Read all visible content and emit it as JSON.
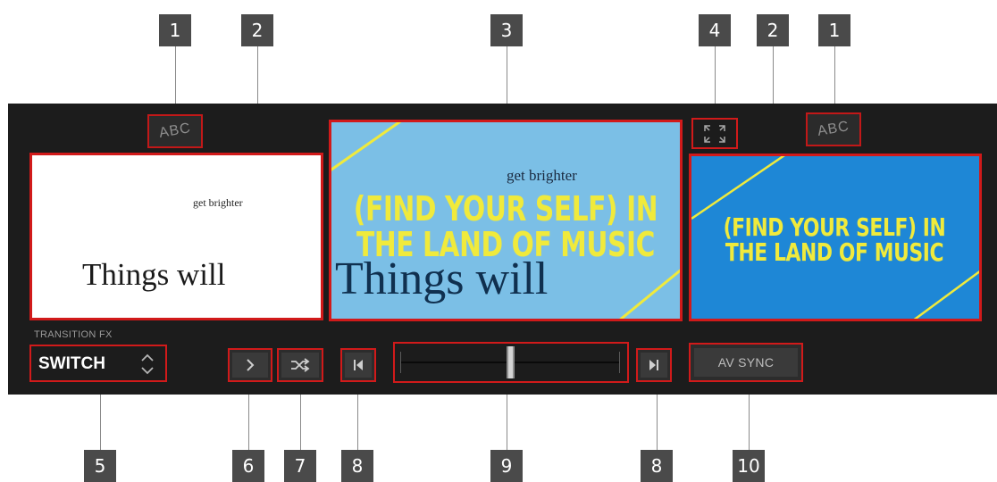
{
  "callouts": {
    "top": [
      "1",
      "2",
      "3",
      "4",
      "2",
      "1"
    ],
    "bottom": [
      "5",
      "6",
      "7",
      "8",
      "9",
      "8",
      "10"
    ]
  },
  "decks": {
    "left_abc": "ABC",
    "right_abc": "ABC"
  },
  "screens": {
    "left": {
      "small_text": "get brighter",
      "big_text": "Things will"
    },
    "center": {
      "small_text": "get brighter",
      "yellow_line1": "(FIND YOUR SELF) IN",
      "yellow_line2": "THE LAND OF MUSIC",
      "big_text": "Things will"
    },
    "right": {
      "yellow_line1": "(FIND YOUR SELF) IN",
      "yellow_line2": "THE LAND OF MUSIC"
    }
  },
  "transition": {
    "label": "TRANSITION FX",
    "value": "SWITCH"
  },
  "buttons": {
    "av_sync": "AV SYNC"
  },
  "crossfader": {
    "position": 0.5
  },
  "colors": {
    "panel_bg": "#1c1c1c",
    "highlight": "#d11a1a",
    "center_screen_bg": "#7bbfe6",
    "right_screen_bg": "#1e87d6",
    "lyric_yellow": "#f0ea3c"
  },
  "icons": {
    "fullscreen": "expand-icon",
    "play": "chevron-right-icon",
    "shuffle": "shuffle-icon",
    "prev": "skip-previous-icon",
    "next": "skip-next-icon",
    "selector": "up-down-chevron-icon"
  }
}
